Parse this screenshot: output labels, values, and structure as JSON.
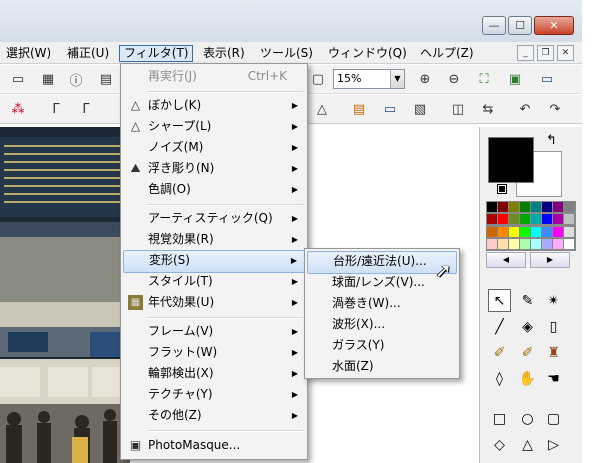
{
  "menubar": {
    "items": [
      "選択(W)",
      "補正(U)",
      "フィルタ(T)",
      "表示(R)",
      "ツール(S)",
      "ウィンドウ(Q)",
      "ヘルプ(Z)"
    ]
  },
  "toolbar": {
    "zoom_value": "15%"
  },
  "filter_menu": {
    "items": [
      {
        "label": "再実行(J)",
        "shortcut": "Ctrl+K"
      },
      {
        "label": "ぼかし(K)"
      },
      {
        "label": "シャープ(L)"
      },
      {
        "label": "ノイズ(M)"
      },
      {
        "label": "浮き彫り(N)"
      },
      {
        "label": "色調(O)"
      },
      {
        "label": "アーティスティック(Q)"
      },
      {
        "label": "視覚効果(R)"
      },
      {
        "label": "変形(S)"
      },
      {
        "label": "スタイル(T)"
      },
      {
        "label": "年代効果(U)"
      },
      {
        "label": "フレーム(V)"
      },
      {
        "label": "フラット(W)"
      },
      {
        "label": "輪郭検出(X)"
      },
      {
        "label": "テクチャ(Y)"
      },
      {
        "label": "その他(Z)"
      },
      {
        "label": "PhotoMasque..."
      }
    ]
  },
  "transform_submenu": {
    "items": [
      {
        "label": "台形/遠近法(U)..."
      },
      {
        "label": "球面/レンズ(V)..."
      },
      {
        "label": "渦巻き(W)..."
      },
      {
        "label": "波形(X)..."
      },
      {
        "label": "ガラス(Y)"
      },
      {
        "label": "水面(Z)"
      }
    ]
  },
  "colors": {
    "highlight": "#cde0f6",
    "foreground": "#000000",
    "background": "#ffffff"
  },
  "icons": [
    "ellipsis-icon",
    "warning-icon",
    "blur-icon",
    "sharpen-icon",
    "emboss-icon",
    "vintage-icon",
    "photomasque-icon",
    "cursor-icon"
  ]
}
